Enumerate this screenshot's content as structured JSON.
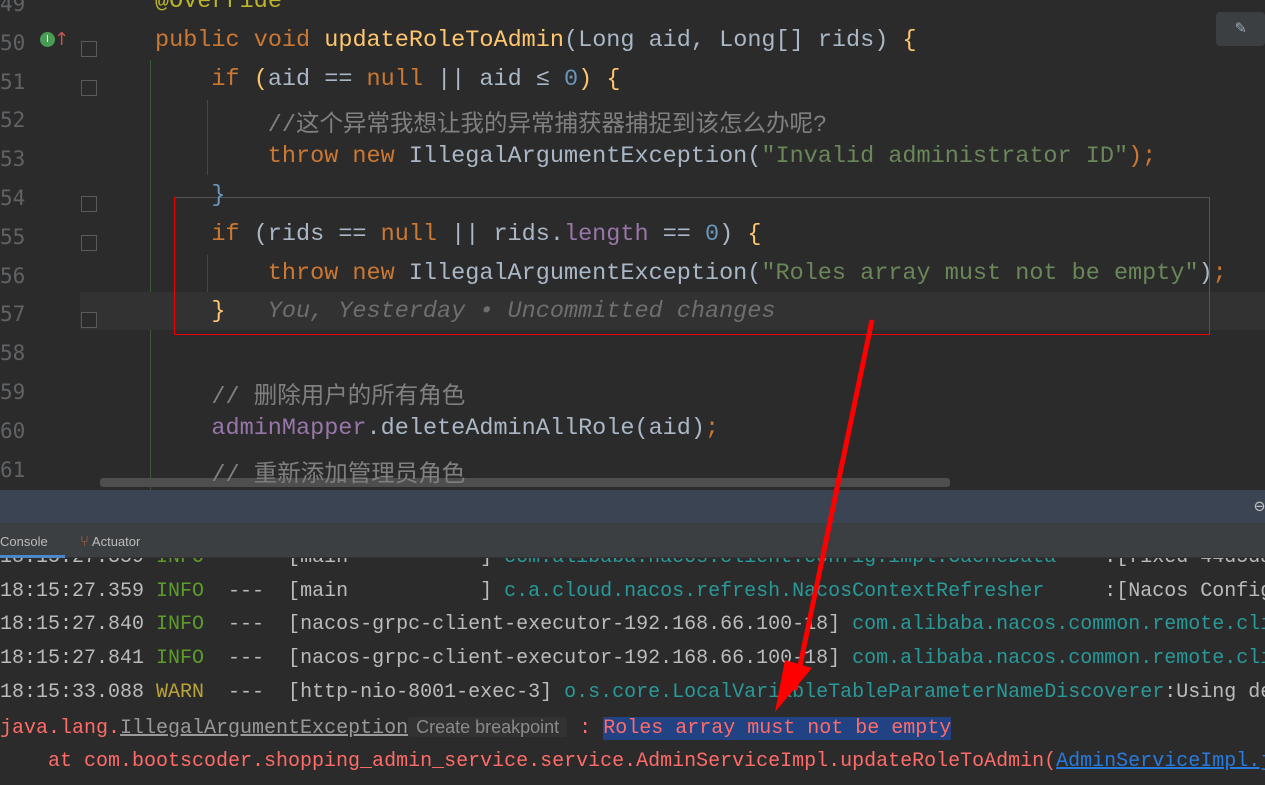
{
  "editor": {
    "lines": [
      {
        "no": "49",
        "parts": [
          [
            "ann",
            "@Override"
          ]
        ],
        "indent": 0
      },
      {
        "no": "50",
        "parts": [
          [
            "kw",
            "public void "
          ],
          [
            "fn",
            "updateRoleToAdmin"
          ],
          [
            "var",
            "(Long aid, Long[] rids) "
          ],
          [
            "fn",
            "{"
          ]
        ],
        "indent": 0
      },
      {
        "no": "51",
        "parts": [
          [
            "kw",
            "if "
          ],
          [
            "fn",
            "("
          ],
          [
            "var",
            "aid "
          ],
          [
            "var",
            "== "
          ],
          [
            "kw",
            "null "
          ],
          [
            "var",
            "|| aid "
          ],
          [
            "var",
            "≤ "
          ],
          [
            "num",
            "0"
          ],
          [
            "fn",
            ") {"
          ]
        ],
        "indent": 4
      },
      {
        "no": "52",
        "parts": [
          [
            "cm",
            "//这个异常我想让我的异常捕获器捕捉到该怎么办呢?"
          ]
        ],
        "indent": 8
      },
      {
        "no": "53",
        "parts": [
          [
            "kw",
            "throw new "
          ],
          [
            "var",
            "IllegalArgumentException("
          ],
          [
            "str",
            "\"Invalid administrator ID\""
          ],
          [
            "kw",
            ")"
          ],
          [
            "kw",
            ";"
          ]
        ],
        "indent": 8
      },
      {
        "no": "54",
        "parts": [
          [
            "num",
            "}"
          ]
        ],
        "indent": 4
      },
      {
        "no": "55",
        "parts": [
          [
            "kw",
            "if "
          ],
          [
            "var",
            "(rids == "
          ],
          [
            "kw",
            "null "
          ],
          [
            "var",
            "|| rids."
          ],
          [
            "fld",
            "length "
          ],
          [
            "var",
            "== "
          ],
          [
            "num",
            "0"
          ],
          [
            "var",
            ") "
          ],
          [
            "fn",
            "{"
          ]
        ],
        "indent": 4
      },
      {
        "no": "56",
        "parts": [
          [
            "kw",
            "throw new "
          ],
          [
            "var",
            "IllegalArgumentException("
          ],
          [
            "str",
            "\"Roles array must not be empty\""
          ],
          [
            "var",
            ")"
          ],
          [
            "kw",
            ";"
          ]
        ],
        "indent": 8
      },
      {
        "no": "57",
        "parts": [
          [
            "fn",
            "}"
          ],
          [
            "hint",
            "   You, Yesterday • Uncommitted changes"
          ]
        ],
        "indent": 4
      },
      {
        "no": "58",
        "parts": [],
        "indent": 0
      },
      {
        "no": "59",
        "parts": [
          [
            "cm",
            "// 删除用户的所有角色"
          ]
        ],
        "indent": 4
      },
      {
        "no": "60",
        "parts": [
          [
            "mp",
            "adminMapper"
          ],
          [
            "var",
            "."
          ],
          [
            "var",
            "deleteAdminAllRole(aid)"
          ],
          [
            "kw",
            ";"
          ]
        ],
        "indent": 4
      },
      {
        "no": "61",
        "parts": [
          [
            "cm",
            "// 重新添加管理员角色"
          ]
        ],
        "indent": 4
      }
    ]
  },
  "tool_tabs": [
    {
      "label": "Console",
      "icon": "console"
    },
    {
      "label": "Actuator",
      "icon": "actuator-icon"
    }
  ],
  "console": {
    "lines": [
      [
        [
          "",
          "18:15:27.359 "
        ],
        [
          "info",
          "INFO"
        ],
        [
          "",
          "  ---  [main           ] "
        ],
        [
          "teal",
          "com.alibaba.nacos.client.config.impl.CacheData"
        ],
        [
          "",
          "    :[fixed-44d5da"
        ]
      ],
      [
        [
          "",
          "18:15:27.359 "
        ],
        [
          "info",
          "INFO"
        ],
        [
          "",
          "  ---  [main           ] "
        ],
        [
          "teal",
          "c.a.cloud.nacos.refresh.NacosContextRefresher"
        ],
        [
          "",
          "     :[Nacos Config"
        ]
      ],
      [
        [
          "",
          "18:15:27.840 "
        ],
        [
          "info",
          "INFO"
        ],
        [
          "",
          "  ---  [nacos-grpc-client-executor-192.168.66.100-18] "
        ],
        [
          "teal",
          "com.alibaba.nacos.common.remote.cli"
        ]
      ],
      [
        [
          "",
          "18:15:27.841 "
        ],
        [
          "info",
          "INFO"
        ],
        [
          "",
          "  ---  [nacos-grpc-client-executor-192.168.66.100-18] "
        ],
        [
          "teal",
          "com.alibaba.nacos.common.remote.cli"
        ]
      ],
      [
        [
          "",
          "18:15:33.088 "
        ],
        [
          "warn",
          "WARN"
        ],
        [
          "",
          "  ---  [http-nio-8001-exec-3] "
        ],
        [
          "teal",
          "o.s.core.LocalVariableTableParameterNameDiscoverer"
        ],
        [
          "",
          ":Using de"
        ]
      ]
    ],
    "exception_prefix": "java.lang.",
    "exception_class": "IllegalArgumentException",
    "breakpoint_hint": "Create breakpoint",
    "separator": " : ",
    "message": "Roles array must not be empty",
    "stack_prefix": "    at com.bootscoder.shopping_admin_service.service.AdminServiceImpl.updateRoleToAdmin(",
    "stack_link": "AdminServiceImpl.java"
  },
  "colors": {
    "annotation_arrow": "#ff0000",
    "selection": "#214283"
  }
}
